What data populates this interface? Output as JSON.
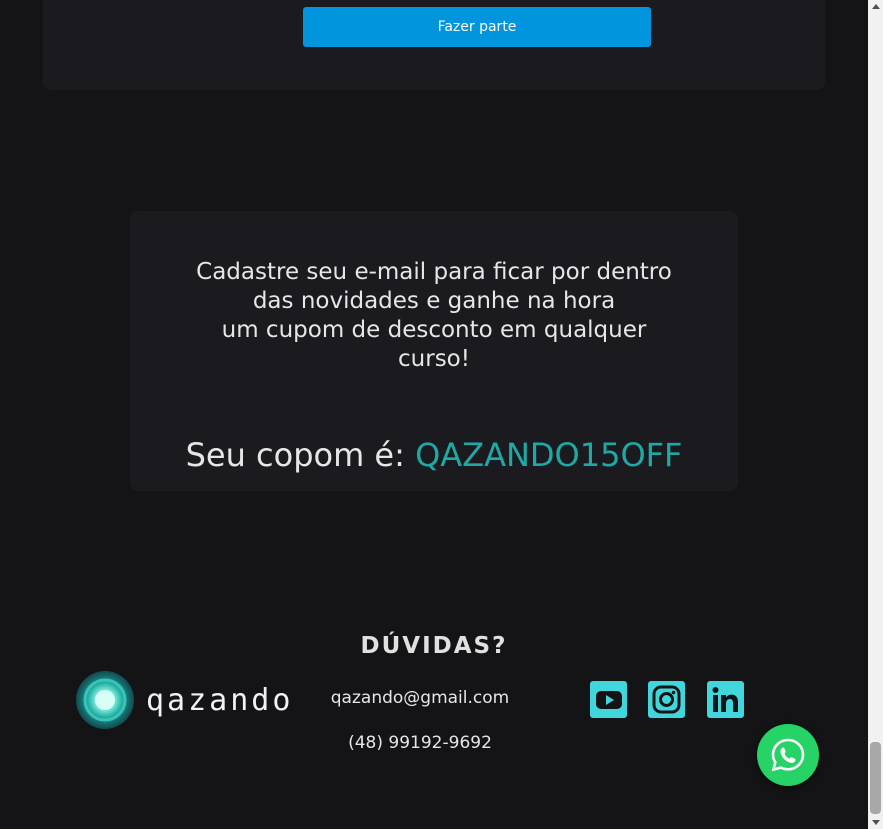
{
  "join": {
    "label": "Fazer parte",
    "color": "#0095dc"
  },
  "newsletter": {
    "lines": [
      "Cadastre seu e-mail para ficar por dentro",
      "das novidades e ganhe na hora",
      "um cupom de desconto em qualquer",
      "curso!"
    ],
    "coupon_prefix": "Seu copom é:",
    "coupon_code": "QAZANDO15OFF",
    "coupon_color": "#1fa9a5"
  },
  "footer": {
    "doubts_title": "DÚVIDAS?",
    "logo_text": "qazando",
    "email": "qazando@gmail.com",
    "phone": "(48) 99192-9692",
    "social": [
      {
        "name": "youtube-icon"
      },
      {
        "name": "instagram-icon"
      },
      {
        "name": "linkedin-icon"
      }
    ],
    "accent_color": "#40d6dc"
  },
  "whatsapp": {
    "icon": "whatsapp-icon",
    "color": "#25d366"
  }
}
